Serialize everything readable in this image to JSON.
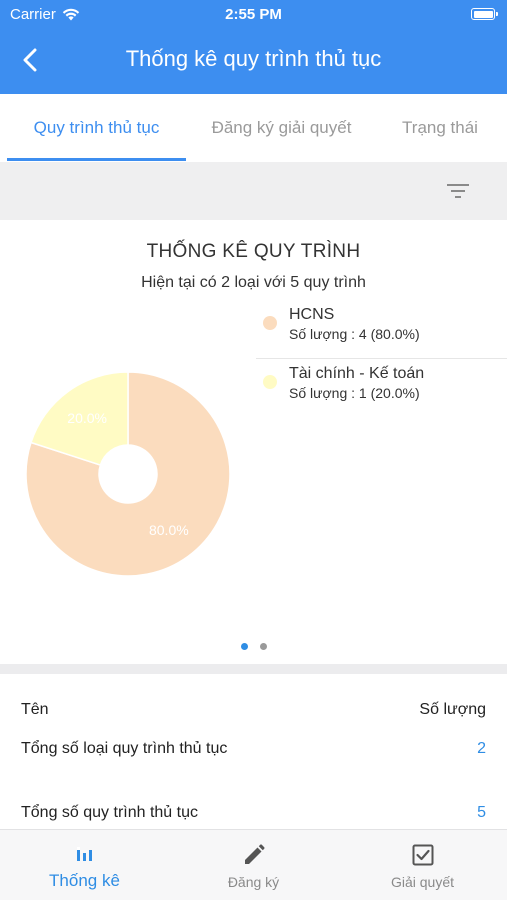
{
  "status_bar": {
    "carrier": "Carrier",
    "time": "2:55 PM"
  },
  "header": {
    "title": "Thống kê quy trình thủ tục",
    "back_icon": "chevron-left-icon"
  },
  "tabs": [
    {
      "label": "Quy trình thủ tục",
      "active": true
    },
    {
      "label": "Đăng ký giải quyết",
      "active": false
    },
    {
      "label": "Trạng thái",
      "active": false
    }
  ],
  "filter": {
    "icon": "filter-icon"
  },
  "chart_data": {
    "type": "pie",
    "title": "THỐNG KÊ QUY TRÌNH",
    "subtitle": "Hiện tại có 2 loại với 5 quy trình",
    "categories": [
      "HCNS",
      "Tài chính - Kế toán"
    ],
    "values": [
      4,
      1
    ],
    "percent_labels": [
      "80.0%",
      "20.0%"
    ],
    "legend_counts": [
      "Số lượng : 4 (80.0%)",
      "Số lượng : 1 (20.0%)"
    ],
    "colors": [
      "#fbdcbe",
      "#fffbc4"
    ],
    "legend_position": "right",
    "donut": true
  },
  "pager": {
    "count": 2,
    "active": 0
  },
  "stats": {
    "header_name": "Tên",
    "header_value": "Số lượng",
    "rows": [
      {
        "label": "Tổng số loại quy trình thủ tục",
        "value": "2"
      },
      {
        "label": "Tổng số quy trình thủ tục",
        "value": "5"
      }
    ]
  },
  "tabbar": [
    {
      "label": "Thống kê",
      "icon": "bar-chart-icon",
      "active": true
    },
    {
      "label": "Đăng ký",
      "icon": "pencil-icon",
      "active": false
    },
    {
      "label": "Giải quyết",
      "icon": "checkbox-icon",
      "active": false
    }
  ],
  "colors": {
    "primary": "#3d8ef0",
    "accent": "#2f8de4"
  }
}
